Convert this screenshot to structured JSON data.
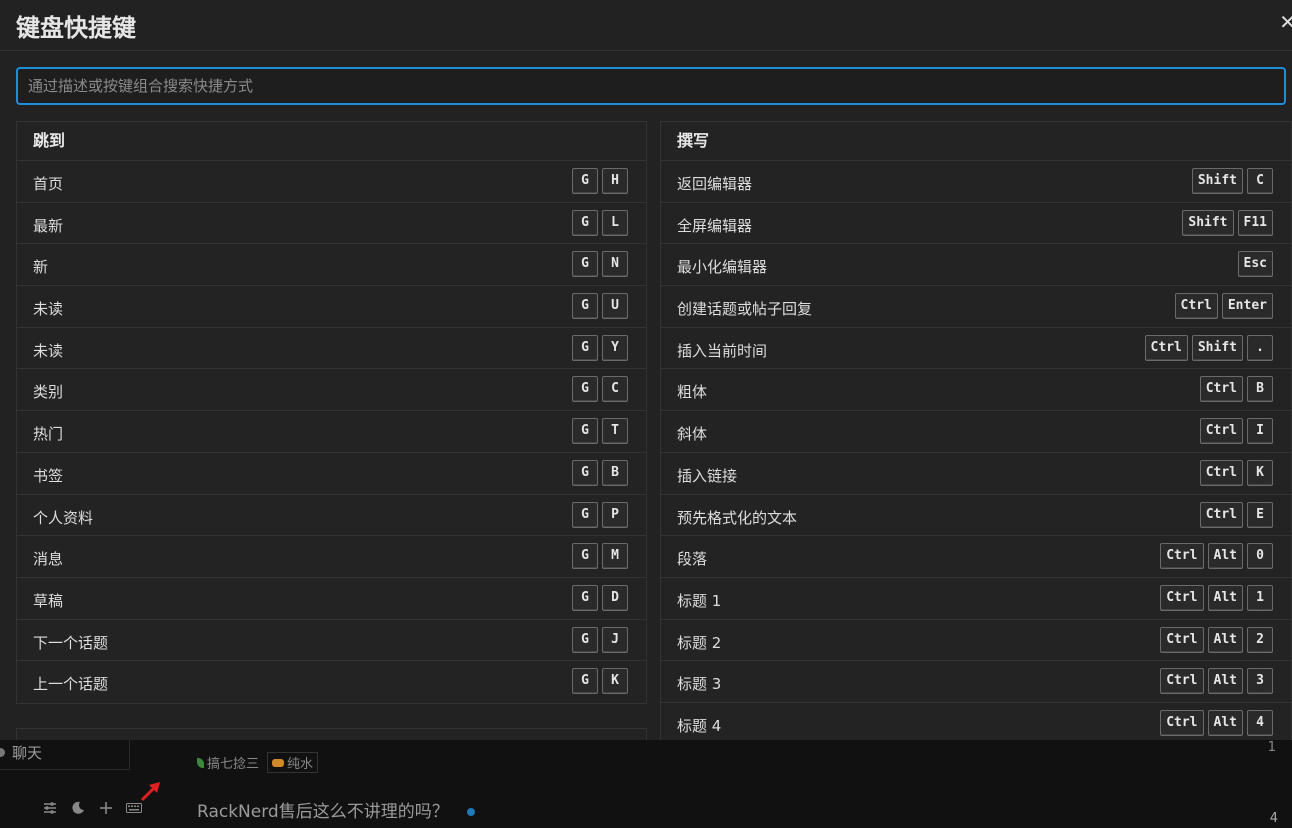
{
  "modal": {
    "title": "键盘快捷键",
    "close_icon": "close-icon",
    "search_placeholder": "通过描述或按键组合搜索快捷方式"
  },
  "sections": {
    "jump": {
      "title": "跳到",
      "rows": [
        {
          "label": "首页",
          "keys": [
            "G",
            "H"
          ]
        },
        {
          "label": "最新",
          "keys": [
            "G",
            "L"
          ]
        },
        {
          "label": "新",
          "keys": [
            "G",
            "N"
          ]
        },
        {
          "label": "未读",
          "keys": [
            "G",
            "U"
          ]
        },
        {
          "label": "未读",
          "keys": [
            "G",
            "Y"
          ]
        },
        {
          "label": "类别",
          "keys": [
            "G",
            "C"
          ]
        },
        {
          "label": "热门",
          "keys": [
            "G",
            "T"
          ]
        },
        {
          "label": "书签",
          "keys": [
            "G",
            "B"
          ]
        },
        {
          "label": "个人资料",
          "keys": [
            "G",
            "P"
          ]
        },
        {
          "label": "消息",
          "keys": [
            "G",
            "M"
          ]
        },
        {
          "label": "草稿",
          "keys": [
            "G",
            "D"
          ]
        },
        {
          "label": "下一个话题",
          "keys": [
            "G",
            "J"
          ]
        },
        {
          "label": "上一个话题",
          "keys": [
            "G",
            "K"
          ]
        }
      ]
    },
    "compose": {
      "title": "撰写",
      "rows": [
        {
          "label": "返回编辑器",
          "keys": [
            "Shift",
            "C"
          ]
        },
        {
          "label": "全屏编辑器",
          "keys": [
            "Shift",
            "F11"
          ]
        },
        {
          "label": "最小化编辑器",
          "keys": [
            "Esc"
          ]
        },
        {
          "label": "创建话题或帖子回复",
          "keys": [
            "Ctrl",
            "Enter"
          ]
        },
        {
          "label": "插入当前时间",
          "keys": [
            "Ctrl",
            "Shift",
            "."
          ]
        },
        {
          "label": "粗体",
          "keys": [
            "Ctrl",
            "B"
          ]
        },
        {
          "label": "斜体",
          "keys": [
            "Ctrl",
            "I"
          ]
        },
        {
          "label": "插入链接",
          "keys": [
            "Ctrl",
            "K"
          ]
        },
        {
          "label": "预先格式化的文本",
          "keys": [
            "Ctrl",
            "E"
          ]
        },
        {
          "label": "段落",
          "keys": [
            "Ctrl",
            "Alt",
            "0"
          ]
        },
        {
          "label": "标题 1",
          "keys": [
            "Ctrl",
            "Alt",
            "1"
          ]
        },
        {
          "label": "标题 2",
          "keys": [
            "Ctrl",
            "Alt",
            "2"
          ]
        },
        {
          "label": "标题 3",
          "keys": [
            "Ctrl",
            "Alt",
            "3"
          ]
        },
        {
          "label": "标题 4",
          "keys": [
            "Ctrl",
            "Alt",
            "4"
          ]
        }
      ]
    }
  },
  "background": {
    "sidebar_item": "聊天",
    "topic1_title": "",
    "topic1_author": "搞七捻三",
    "topic1_category": "纯水",
    "topic1_count": "1",
    "topic2_title": "RackNerd售后这么不讲理的吗？",
    "topic2_count": "4",
    "tools": [
      "sliders-icon",
      "moon-icon",
      "plus-icon",
      "keyboard-icon"
    ]
  },
  "colors": {
    "modal_bg": "#222222",
    "accent": "#1b8fd8",
    "arrow": "#e02020"
  }
}
